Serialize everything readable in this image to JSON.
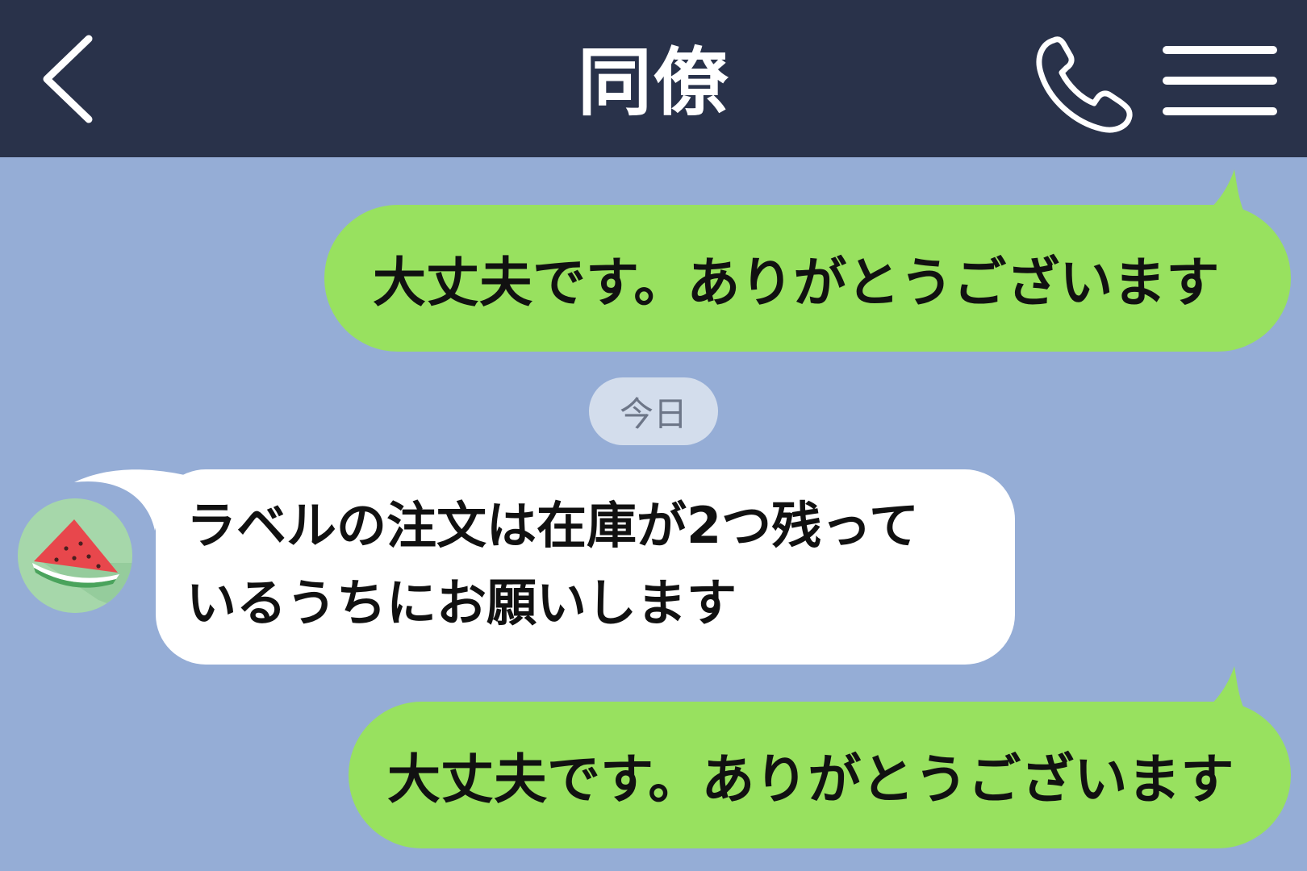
{
  "header": {
    "title": "同僚",
    "back_icon": "chevron-left-icon",
    "call_icon": "phone-icon",
    "menu_icon": "hamburger-menu-icon"
  },
  "messages": [
    {
      "side": "sent",
      "text": "大丈夫です。ありがとうございます"
    },
    {
      "side": "received",
      "avatar_icon": "watermelon-icon",
      "lines": [
        "ラベルの注文は在庫が2つ残って",
        "いるうちにお願いします"
      ]
    },
    {
      "side": "sent",
      "text": "大丈夫です。ありがとうございます"
    }
  ],
  "date_separator": "今日",
  "colors": {
    "header_bg": "#29324a",
    "chat_bg": "#95add6",
    "sent_bubble": "#98e15f",
    "received_bubble": "#ffffff",
    "date_pill": "#d3ddec"
  }
}
